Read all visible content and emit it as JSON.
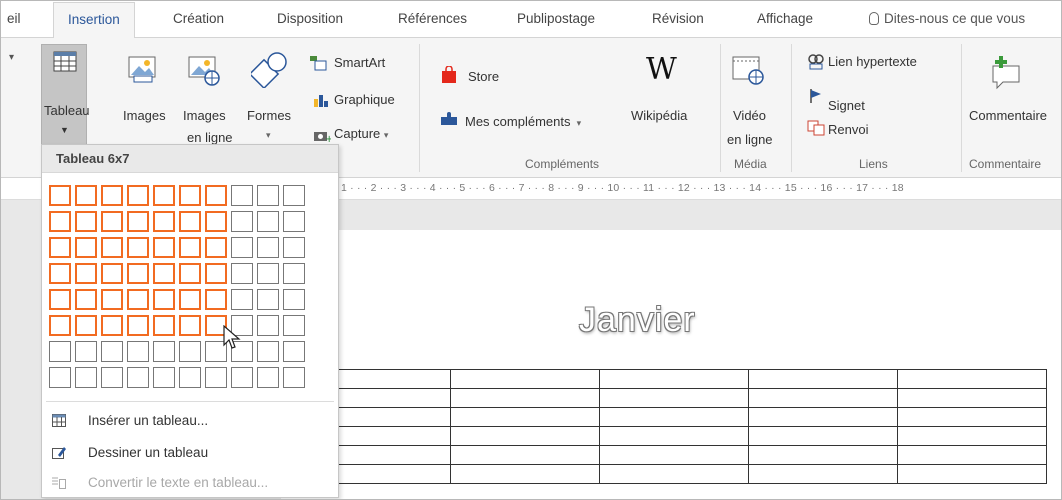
{
  "tabs": {
    "accueil_partial": "eil",
    "insertion": "Insertion",
    "creation": "Création",
    "disposition": "Disposition",
    "references": "Références",
    "publipostage": "Publipostage",
    "revision": "Révision",
    "affichage": "Affichage",
    "tell_me": "Dites-nous ce que vous"
  },
  "ribbon": {
    "tableau": "Tableau",
    "images": "Images",
    "images_en_ligne_1": "Images",
    "images_en_ligne_2": "en ligne",
    "formes": "Formes",
    "smartart": "SmartArt",
    "graphique": "Graphique",
    "capture": "Capture",
    "store": "Store",
    "mes_complements": "Mes compléments",
    "wikipedia": "Wikipédia",
    "video_1": "Vidéo",
    "video_2": "en ligne",
    "lien_hypertexte": "Lien hypertexte",
    "signet": "Signet",
    "renvoi": "Renvoi",
    "commentaire": "Commentaire",
    "group_complements": "Compléments",
    "group_media": "Média",
    "group_liens": "Liens",
    "group_commentaires": "Commentaire"
  },
  "dropdown": {
    "header": "Tableau 6x7",
    "grid_cols": 10,
    "grid_rows": 8,
    "selected_cols": 7,
    "selected_rows": 6,
    "insert_table": "Insérer un tableau...",
    "draw_table": "Dessiner un tableau",
    "convert_text": "Convertir le texte en tableau..."
  },
  "ruler": {
    "text": "1 · · · 2 · · · 3 · · · 4 · · · 5 · · · 6 · · · 7 · · · 8 · · · 9 · · · 10 · · · 11 · · · 12 · · · 13 · · · 14 · · · 15 · · · 16 · · · 17 · · · 18"
  },
  "document": {
    "title": "Janvier",
    "table_rows": 6,
    "table_cols": 5
  },
  "colors": {
    "accent": "#2b579a",
    "selection": "#f26b21",
    "ribbon_bg": "#f5f5f5"
  }
}
